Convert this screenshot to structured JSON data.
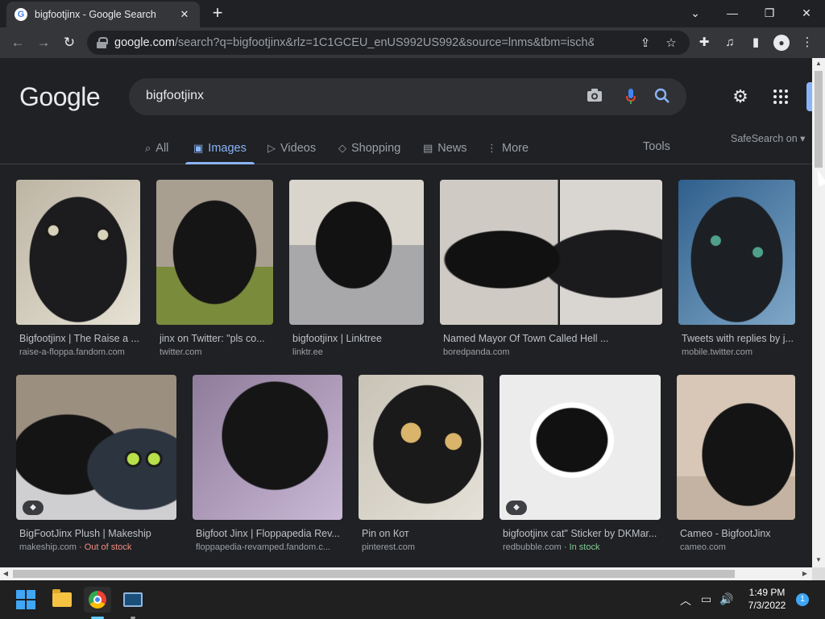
{
  "browser": {
    "tab_title": "bigfootjinx - Google Search",
    "tab_favicon": "G",
    "tab_close": "✕",
    "new_tab": "+",
    "url_host": "google.com",
    "url_rest": "/search?q=bigfootjinx&rlz=1C1GCEU_enUS992US992&source=lnms&tbm=isch&sa=X&v...",
    "icons": {
      "back": "←",
      "forward": "→",
      "reload": "↻",
      "share": "⇪",
      "star": "☆",
      "extensions": "✚",
      "media": "♫",
      "sidebar": "▮",
      "menu": "⋮",
      "minimize": "—",
      "restore": "❐",
      "close": "✕",
      "tab_search": "⌄"
    }
  },
  "page": {
    "logo": "Google",
    "query": "bigfootjinx",
    "tabs": [
      {
        "label": "All",
        "icon": "⌕"
      },
      {
        "label": "Images",
        "icon": "▣"
      },
      {
        "label": "Videos",
        "icon": "▷"
      },
      {
        "label": "Shopping",
        "icon": "◇"
      },
      {
        "label": "News",
        "icon": "▤"
      },
      {
        "label": "More",
        "icon": "⋮"
      }
    ],
    "tools": "Tools",
    "safesearch": "SafeSearch on ▾",
    "results_row1": [
      {
        "title": "Bigfootjinx | The Raise a ...",
        "source": "raise-a-floppa.fandom.com"
      },
      {
        "title": "jinx on Twitter: \"pls co...",
        "source": "twitter.com"
      },
      {
        "title": "bigfootjinx | Linktree",
        "source": "linktr.ee"
      },
      {
        "title": "Named Mayor Of Town Called Hell ...",
        "source": "boredpanda.com"
      },
      {
        "title": "Tweets with replies by j...",
        "source": "mobile.twitter.com"
      }
    ],
    "results_row2": [
      {
        "title": "BigFootJinx Plush | Makeship",
        "source": "makeship.com",
        "stock": "· Out of stock"
      },
      {
        "title": "Bigfoot Jinx | Floppapedia Rev...",
        "source": "floppapedia-revamped.fandom.c..."
      },
      {
        "title": "Pin on Кот",
        "source": "pinterest.com"
      },
      {
        "title": "bigfootjinx cat\" Sticker by DKMar...",
        "source": "redbubble.com",
        "stock": "· In stock"
      },
      {
        "title": "Cameo - BigfootJinx",
        "source": "cameo.com"
      }
    ],
    "tag_badge": "◆"
  },
  "taskbar": {
    "time": "1:49 PM",
    "date": "7/3/2022",
    "notifications": "1",
    "tray_chevron": "︿",
    "tray_network": "▭",
    "tray_volume": "🔊"
  },
  "colors": {
    "background": "#202124",
    "accent": "#8ab4f8",
    "out_of_stock": "#f28b82",
    "in_stock": "#81c995"
  }
}
